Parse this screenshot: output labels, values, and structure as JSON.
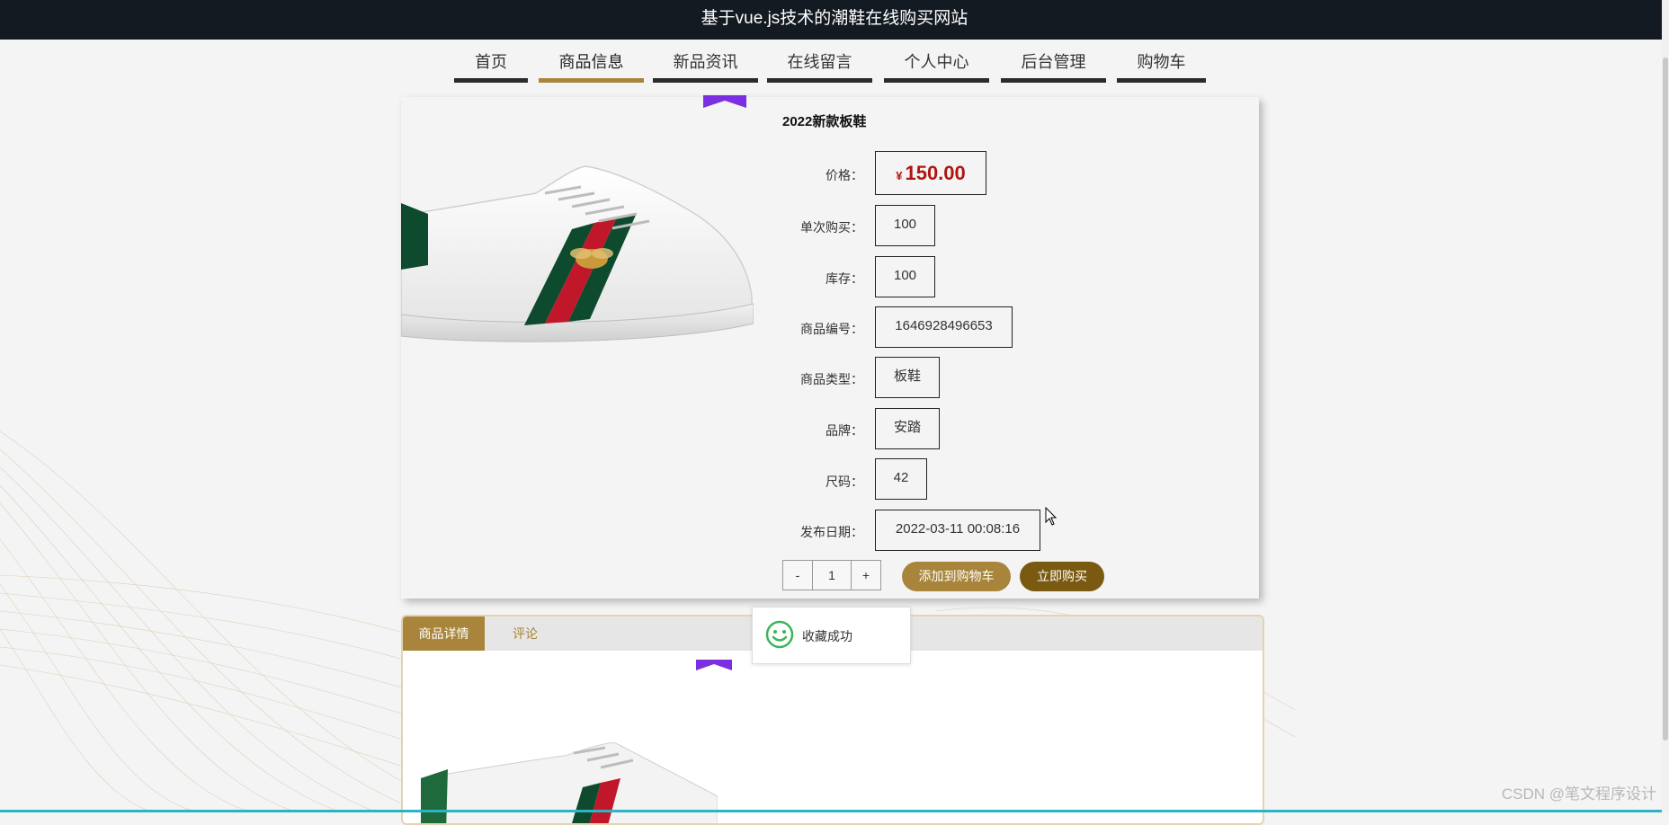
{
  "site": {
    "title": "基于vue.js技术的潮鞋在线购买网站"
  },
  "nav": {
    "items": [
      {
        "label": "首页",
        "active": false
      },
      {
        "label": "商品信息",
        "active": true
      },
      {
        "label": "新品资讯",
        "active": false
      },
      {
        "label": "在线留言",
        "active": false
      },
      {
        "label": "个人中心",
        "active": false
      },
      {
        "label": "后台管理",
        "active": false
      },
      {
        "label": "购物车",
        "active": false
      }
    ]
  },
  "product": {
    "name": "2022新款板鞋",
    "price_label": "价格：",
    "currency": "¥",
    "price": "150.00",
    "fields": [
      {
        "label": "单次购买：",
        "value": "100"
      },
      {
        "label": "库存：",
        "value": "100"
      },
      {
        "label": "商品编号：",
        "value": "1646928496653"
      },
      {
        "label": "商品类型：",
        "value": "板鞋"
      },
      {
        "label": "品牌：",
        "value": "安踏"
      },
      {
        "label": "尺码：",
        "value": "42"
      },
      {
        "label": "发布日期：",
        "value": "2022-03-11 00:08:16"
      }
    ],
    "quantity": {
      "minus": "-",
      "value": "1",
      "plus": "+"
    },
    "add_to_cart": "添加到购物车",
    "buy_now": "立即购买"
  },
  "toast": {
    "message": "收藏成功"
  },
  "tabs": [
    {
      "label": "商品详情",
      "active": true
    },
    {
      "label": "评论",
      "active": false
    }
  ],
  "watermark": "CSDN @笔文程序设计",
  "colors": {
    "accent": "#a8853a",
    "buy_button": "#7a5a10",
    "price": "#b01515",
    "ribbon": "#7b2fe0",
    "topbar": "#141a22"
  }
}
